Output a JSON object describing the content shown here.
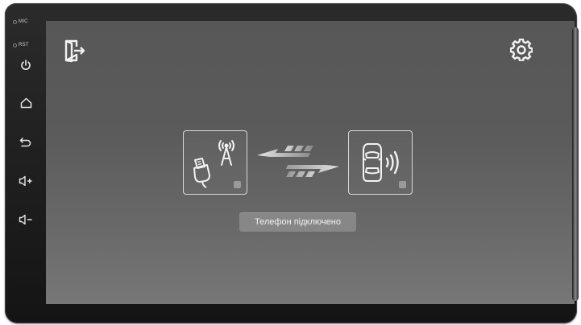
{
  "side_keys": {
    "mic_label": "MIC",
    "rst_label": "RST",
    "icons": [
      "power-icon",
      "home-icon",
      "back-icon",
      "volume-up-icon",
      "volume-down-icon"
    ]
  },
  "screen": {
    "top_left_icon": "exit-icon",
    "top_right_icon": "gear-icon",
    "left_panel_icons": [
      "antenna-icon",
      "usb-plug-icon"
    ],
    "transfer_icon": "bidirectional-arrows-icon",
    "right_panel_icons": [
      "car-icon",
      "signal-waves-icon"
    ],
    "status_label": "Телефон підключено"
  },
  "colors": {
    "screen_background": "#5a5a5a",
    "status_button": "#878787",
    "bezel": "#1c1c1c"
  }
}
